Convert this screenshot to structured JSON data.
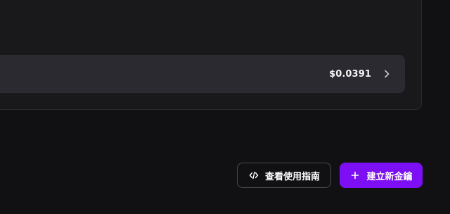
{
  "summary": {
    "cost_value": "$0.0391",
    "chevron_icon": "chevron-right-icon"
  },
  "actions": {
    "view_guide_label": "查看使用指南",
    "view_guide_icon": "code-icon",
    "create_key_label": "建立新金鑰",
    "create_key_icon": "plus-icon"
  },
  "colors": {
    "background": "#111113",
    "panel": "#19191b",
    "row": "#2b2a30",
    "accent": "#7c0ff6",
    "outline": "#4a4a51"
  }
}
